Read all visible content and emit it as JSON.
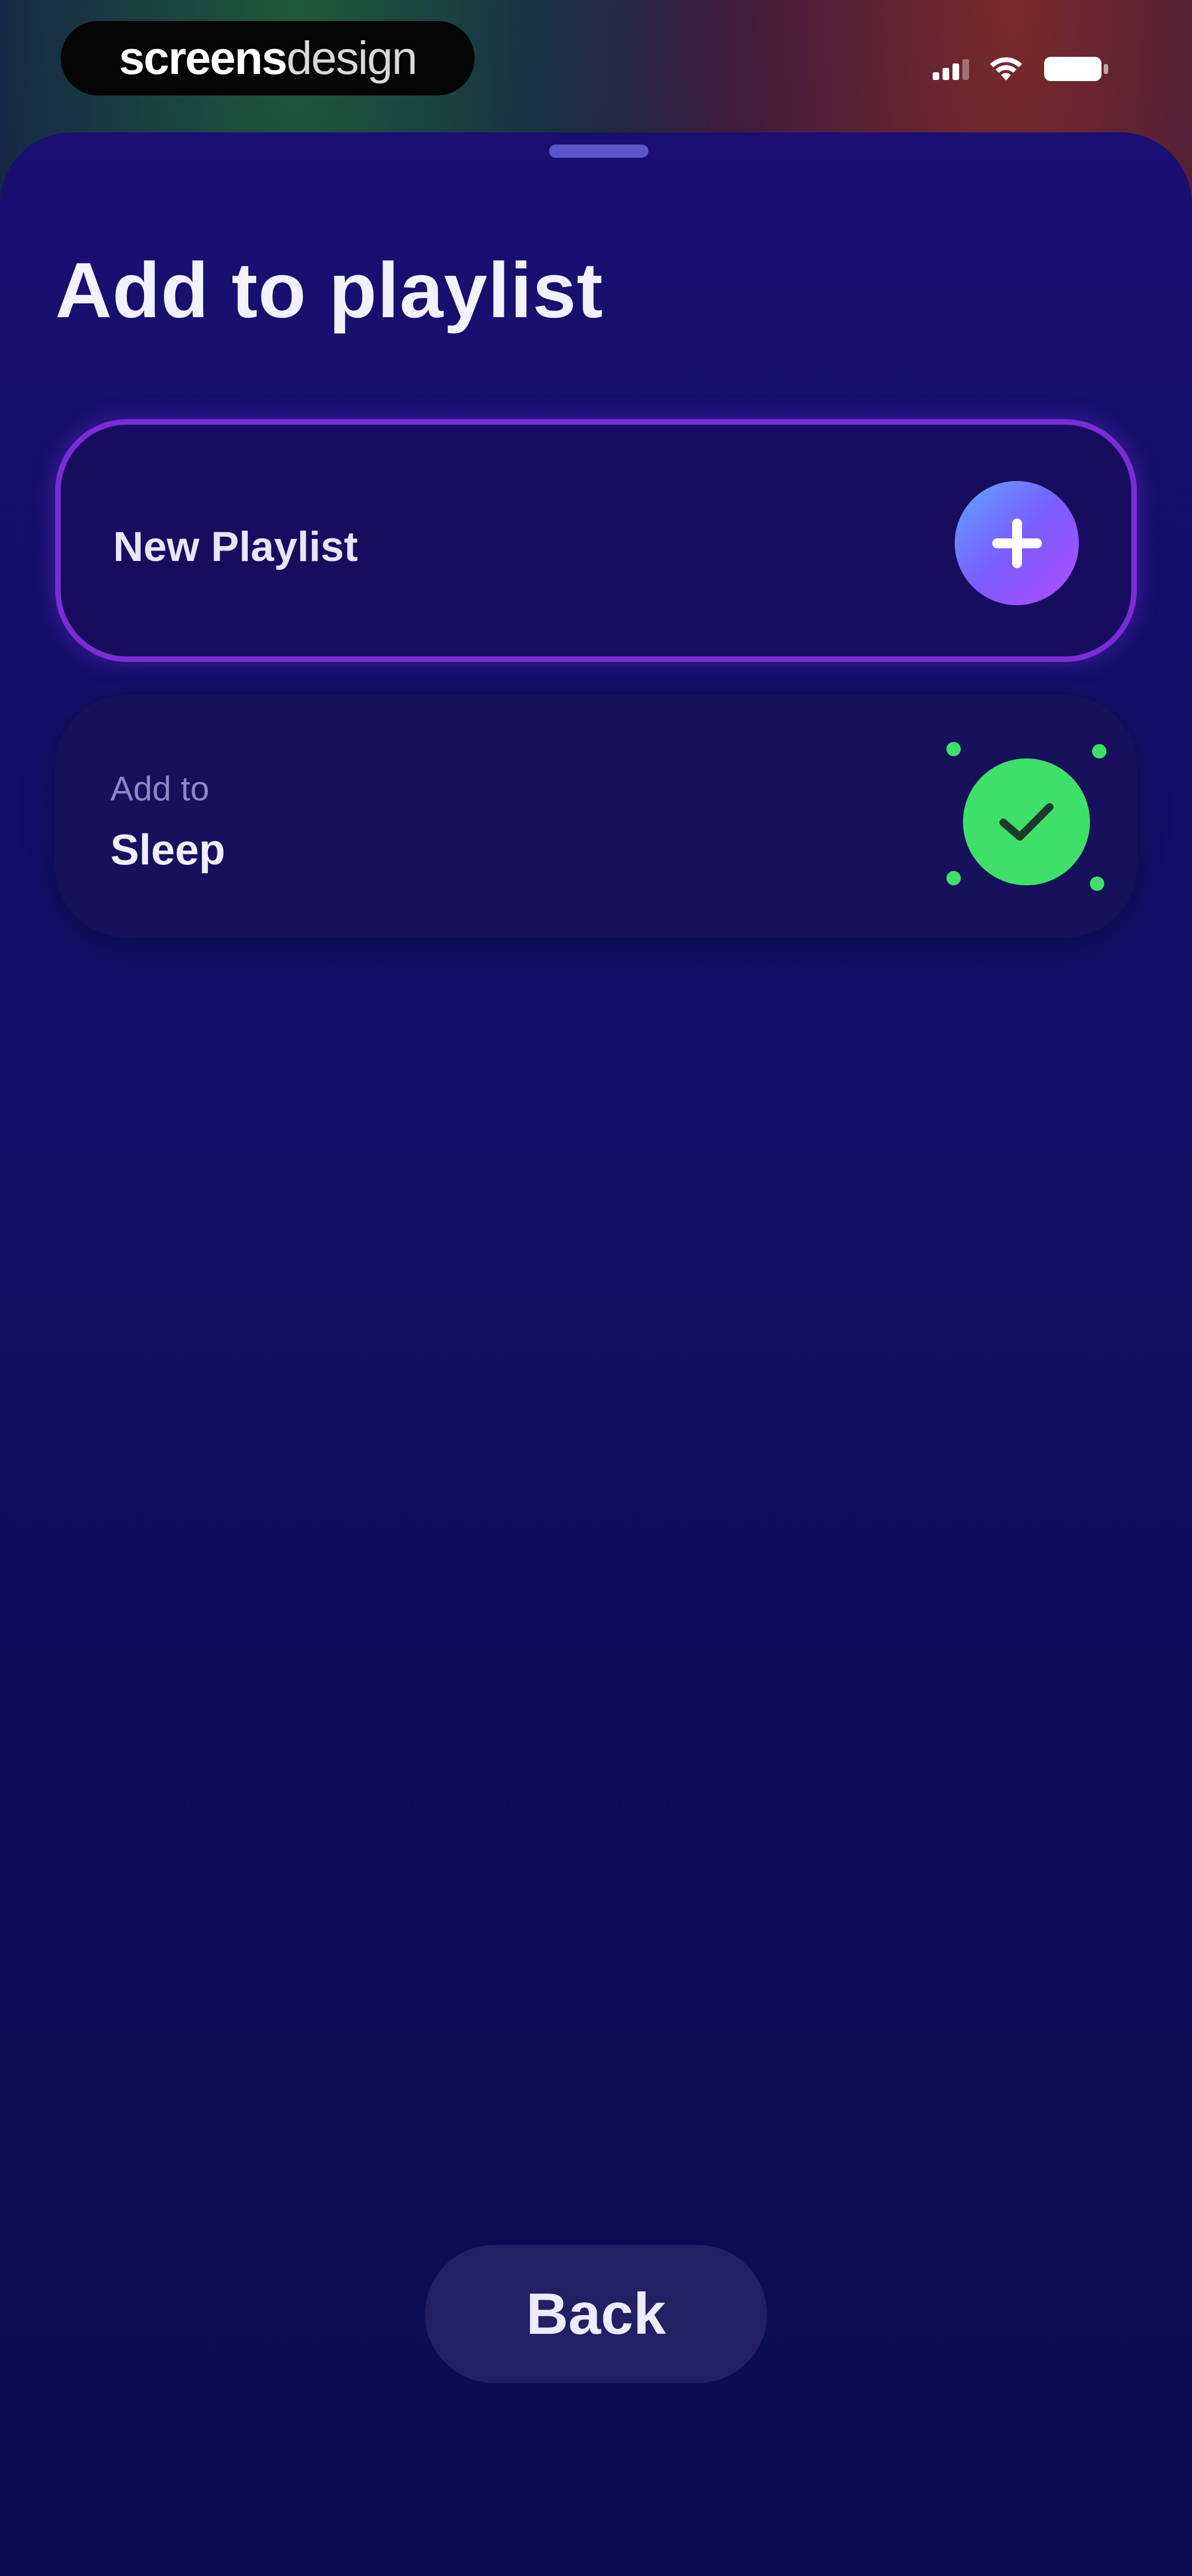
{
  "status_bar": {
    "brand": {
      "bold": "screens",
      "light": "design"
    },
    "icons": [
      "signal-icon",
      "wifi-icon",
      "battery-icon"
    ]
  },
  "sheet": {
    "title": "Add to playlist",
    "new_playlist": {
      "label": "New Playlist",
      "icon": "plus-icon"
    },
    "playlists": [
      {
        "caption": "Add to",
        "name": "Sleep",
        "icon": "check-icon",
        "selected": true
      }
    ],
    "back_label": "Back"
  },
  "colors": {
    "sheet_background": "#12104a",
    "new_playlist_border": "#7b2cd6",
    "check_green": "#3fe06a",
    "plus_gradient": [
      "#5fa6ff",
      "#b24dff"
    ]
  }
}
